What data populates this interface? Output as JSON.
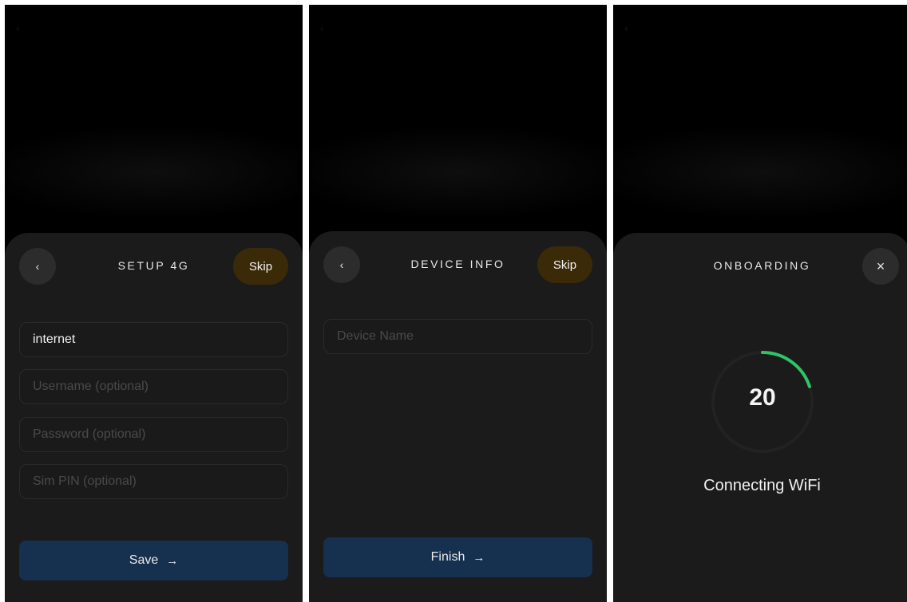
{
  "screens": [
    {
      "title": "SETUP 4G",
      "back_icon": "chevron-left",
      "skip_label": "Skip",
      "fields": [
        {
          "value": "internet",
          "placeholder": ""
        },
        {
          "value": "",
          "placeholder": "Username (optional)"
        },
        {
          "value": "",
          "placeholder": "Password (optional)"
        },
        {
          "value": "",
          "placeholder": "Sim PIN (optional)"
        }
      ],
      "primary_label": "Save",
      "primary_icon": "arrow-right"
    },
    {
      "title": "DEVICE INFO",
      "back_icon": "chevron-left",
      "skip_label": "Skip",
      "fields": [
        {
          "value": "",
          "placeholder": "Device Name"
        }
      ],
      "primary_label": "Finish",
      "primary_icon": "arrow-right"
    },
    {
      "title": "ONBOARDING",
      "close_icon": "close",
      "countdown": "20",
      "progress_fraction": 0.2,
      "status": "Connecting WiFi"
    }
  ],
  "colors": {
    "skip_bg": "#3b2a08",
    "primary_bg": "#16304f",
    "progress": "#2ec46a",
    "ring_track": "#222222"
  }
}
